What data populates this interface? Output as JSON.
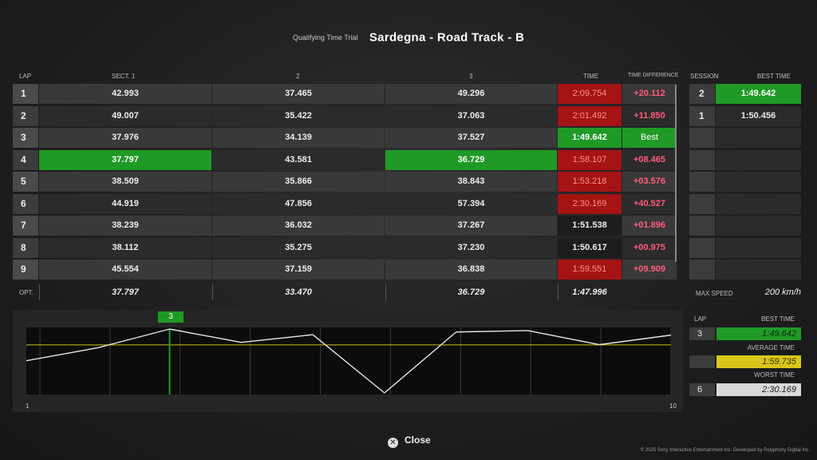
{
  "header": {
    "subtitle": "Qualifying Time Trial",
    "title": "Sardegna - Road Track - B"
  },
  "columns": {
    "lap": "LAP",
    "sect1": "SECT. 1",
    "sect2": "2",
    "sect3": "3",
    "time": "TIME",
    "diff": "TIME DIFFERENCE",
    "session": "SESSION",
    "best_time": "BEST TIME"
  },
  "laps": [
    {
      "lap": "1",
      "s1": "42.993",
      "s2": "37.465",
      "s3": "49.296",
      "time": "2:09.754",
      "diff": "+20.112"
    },
    {
      "lap": "2",
      "s1": "49.007",
      "s2": "35.422",
      "s3": "37.063",
      "time": "2:01.492",
      "diff": "+11.850"
    },
    {
      "lap": "3",
      "s1": "37.976",
      "s2": "34.139",
      "s3": "37.527",
      "time": "1:49.642",
      "diff": "Best"
    },
    {
      "lap": "4",
      "s1": "37.797",
      "s2": "43.581",
      "s3": "36.729",
      "time": "1:58.107",
      "diff": "+08.465"
    },
    {
      "lap": "5",
      "s1": "38.509",
      "s2": "35.866",
      "s3": "38.843",
      "time": "1:53.218",
      "diff": "+03.576"
    },
    {
      "lap": "6",
      "s1": "44.919",
      "s2": "47.856",
      "s3": "57.394",
      "time": "2:30.169",
      "diff": "+40.527"
    },
    {
      "lap": "7",
      "s1": "38.239",
      "s2": "36.032",
      "s3": "37.267",
      "time": "1:51.538",
      "diff": "+01.896"
    },
    {
      "lap": "8",
      "s1": "38.112",
      "s2": "35.275",
      "s3": "37.230",
      "time": "1:50.617",
      "diff": "+00.975"
    },
    {
      "lap": "9",
      "s1": "45.554",
      "s2": "37.159",
      "s3": "36.838",
      "time": "1:59.551",
      "diff": "+09.909"
    }
  ],
  "optimal": {
    "label": "OPT.",
    "s1": "37.797",
    "s2": "33.470",
    "s3": "36.729",
    "time": "1:47.996"
  },
  "sessions": [
    {
      "session": "2",
      "best": "1:49.642"
    },
    {
      "session": "1",
      "best": "1:50.456"
    }
  ],
  "max_speed": {
    "label": "MAX SPEED",
    "value": "200 km/h"
  },
  "graph": {
    "selected_lap_marker": "3",
    "x_start_label": "1",
    "x_end_label": "10",
    "lap_times_seconds": [
      129.754,
      121.492,
      109.642,
      118.107,
      113.218,
      150.169,
      111.538,
      110.617,
      119.551,
      113.5
    ],
    "average_seconds": 119.735,
    "colors": {
      "line": "#e6e6e6",
      "average": "#cfc21a",
      "best": "#1f9a26"
    }
  },
  "legend": {
    "lap_label": "LAP",
    "best_label": "BEST TIME",
    "best_lap": "3",
    "best_value": "1:49.642",
    "avg_label": "AVERAGE TIME",
    "avg_value": "1:59.735",
    "worst_label": "WORST TIME",
    "worst_lap": "6",
    "worst_value": "2:30.169",
    "colors": {
      "best": "#1f9a26",
      "average": "#d9c61a",
      "worst": "#d8d8d8"
    }
  },
  "footer": {
    "close_icon": "circle-x-icon",
    "close_label": "Close",
    "copyright": "© 2025 Sony Interactive Entertainment Inc. Developed by Polyphony Digital Inc."
  }
}
